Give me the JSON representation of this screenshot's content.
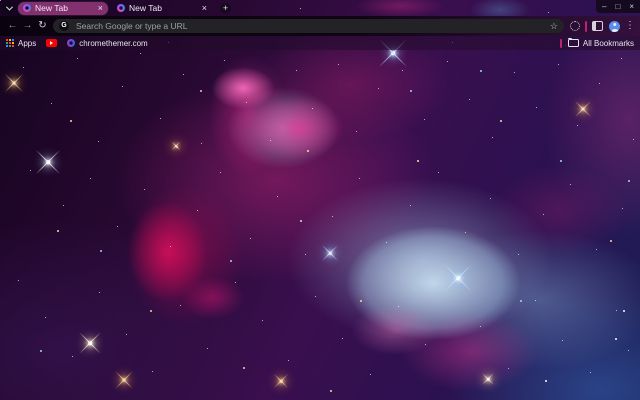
{
  "theme": {
    "active_tab_color": "#82306e",
    "toolbar_color": "#0d0412",
    "omnibox_color": "#232327",
    "accent_separator_color": "#b9256e",
    "avatar_color": "#5b8def",
    "youtube_red": "#ff0000",
    "nebula_pink": "#e0368c",
    "nebula_blue": "#b7d3e8"
  },
  "glyphs": {
    "back_arrow": "←",
    "forward_arrow": "→",
    "reload": "↻",
    "minimize": "–",
    "maximize": "□",
    "close": "×",
    "tab_close": "×",
    "new_tab_plus": "+",
    "google_g": "G",
    "bookmark_star": "☆",
    "menu_dots": "⋮"
  },
  "tabs": [
    {
      "title": "New Tab",
      "active": true
    },
    {
      "title": "New Tab",
      "active": false
    }
  ],
  "omnibox": {
    "placeholder": "Search Google or type a URL"
  },
  "bookmarks_bar": {
    "apps_label": "Apps",
    "site_label": "chromethemer.com",
    "all_bookmarks_label": "All Bookmarks"
  }
}
